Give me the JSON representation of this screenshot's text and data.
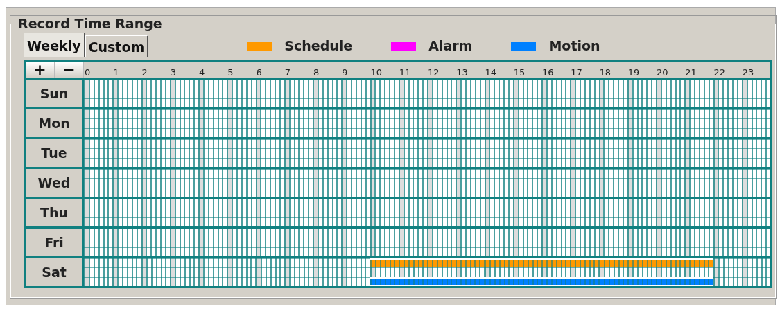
{
  "group_title": "Record Time Range",
  "tabs": [
    {
      "label": "Weekly",
      "selected": true
    },
    {
      "label": "Custom",
      "selected": false
    }
  ],
  "legend": [
    {
      "label": "Schedule",
      "color": "#ff9900"
    },
    {
      "label": "Alarm",
      "color": "#ff00ff"
    },
    {
      "label": "Motion",
      "color": "#0080ff"
    }
  ],
  "zoom_buttons": [
    "+",
    "−"
  ],
  "hours": [
    "0",
    "1",
    "2",
    "3",
    "4",
    "5",
    "6",
    "7",
    "8",
    "9",
    "10",
    "11",
    "12",
    "13",
    "14",
    "15",
    "16",
    "17",
    "18",
    "19",
    "20",
    "21",
    "22",
    "23"
  ],
  "days": [
    {
      "name": "Sun"
    },
    {
      "name": "Mon"
    },
    {
      "name": "Tue"
    },
    {
      "name": "Wed"
    },
    {
      "name": "Thu"
    },
    {
      "name": "Fri"
    },
    {
      "name": "Sat",
      "tracks": [
        {
          "hours_on": [
            false,
            false,
            false,
            false,
            false,
            false,
            false,
            false,
            false,
            false,
            true,
            true,
            true,
            true,
            true,
            true,
            true,
            true,
            true,
            true,
            true,
            true,
            false,
            false
          ]
        },
        {
          "hours_on": [
            false,
            false,
            false,
            false,
            false,
            false,
            false,
            false,
            false,
            false,
            false,
            false,
            false,
            false,
            false,
            false,
            false,
            false,
            false,
            false,
            false,
            false,
            false,
            false
          ]
        },
        {
          "hours_on": [
            false,
            false,
            false,
            false,
            false,
            false,
            false,
            false,
            false,
            false,
            true,
            true,
            true,
            true,
            true,
            true,
            true,
            true,
            true,
            true,
            true,
            true,
            false,
            false
          ]
        }
      ]
    }
  ]
}
